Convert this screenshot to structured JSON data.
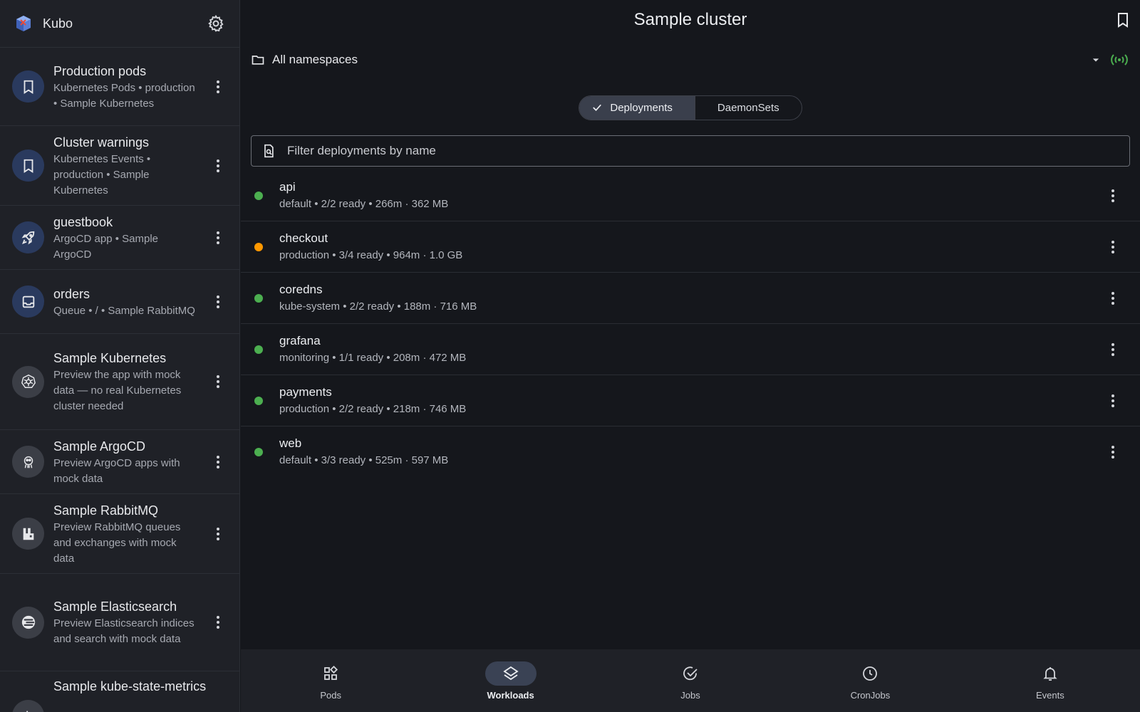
{
  "app": {
    "name": "Kubo"
  },
  "sidebar": {
    "items": [
      {
        "title": "Production pods",
        "subtitle": "Kubernetes Pods • production • Sample Kubernetes",
        "icon": "bookmark-icon"
      },
      {
        "title": "Cluster warnings",
        "subtitle": "Kubernetes Events • production • Sample Kubernetes",
        "icon": "bookmark-icon"
      },
      {
        "title": "guestbook",
        "subtitle": "ArgoCD app • Sample ArgoCD",
        "icon": "rocket-icon"
      },
      {
        "title": "orders",
        "subtitle": "Queue • / • Sample RabbitMQ",
        "icon": "inbox-icon"
      },
      {
        "title": "Sample Kubernetes",
        "subtitle": "Preview the app with mock data — no real Kubernetes cluster needed",
        "icon": "kubernetes-icon"
      },
      {
        "title": "Sample ArgoCD",
        "subtitle": "Preview ArgoCD apps with mock data",
        "icon": "argocd-icon"
      },
      {
        "title": "Sample RabbitMQ",
        "subtitle": "Preview RabbitMQ queues and exchanges with mock data",
        "icon": "rabbitmq-icon"
      },
      {
        "title": "Sample Elasticsearch",
        "subtitle": "Preview Elasticsearch indices and search with mock data",
        "icon": "elasticsearch-icon"
      },
      {
        "title": "Sample kube-state-metrics",
        "subtitle": "",
        "icon": "metrics-icon"
      }
    ]
  },
  "header": {
    "title": "Sample cluster"
  },
  "namespace": {
    "label": "All namespaces"
  },
  "segments": {
    "deployments": "Deployments",
    "daemonsets": "DaemonSets"
  },
  "filter": {
    "placeholder": "Filter deployments by name"
  },
  "deployments": [
    {
      "name": "api",
      "meta": "default • 2/2 ready • 266m · 362 MB",
      "status": "ok"
    },
    {
      "name": "checkout",
      "meta": "production • 3/4 ready • 964m · 1.0 GB",
      "status": "warn"
    },
    {
      "name": "coredns",
      "meta": "kube-system • 2/2 ready • 188m · 716 MB",
      "status": "ok"
    },
    {
      "name": "grafana",
      "meta": "monitoring • 1/1 ready • 208m · 472 MB",
      "status": "ok"
    },
    {
      "name": "payments",
      "meta": "production • 2/2 ready • 218m · 746 MB",
      "status": "ok"
    },
    {
      "name": "web",
      "meta": "default • 3/3 ready • 525m · 597 MB",
      "status": "ok"
    }
  ],
  "bottom_nav": [
    {
      "label": "Pods",
      "icon": "pods-icon"
    },
    {
      "label": "Workloads",
      "icon": "layers-icon",
      "active": true
    },
    {
      "label": "Jobs",
      "icon": "check-circle-icon"
    },
    {
      "label": "CronJobs",
      "icon": "clock-icon"
    },
    {
      "label": "Events",
      "icon": "bell-icon"
    }
  ],
  "colors": {
    "status_ok": "#4caf50",
    "status_warn": "#ff9800",
    "live_indicator": "#4caf50",
    "accent": "#3a4254"
  }
}
